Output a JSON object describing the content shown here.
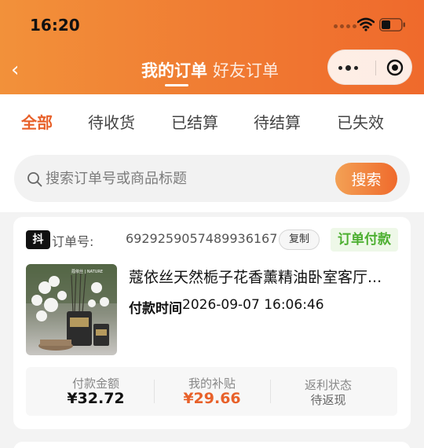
{
  "status_bar": {
    "time": "16:20"
  },
  "header": {
    "tab_mine": "我的订单",
    "tab_friend": "好友订单",
    "back_icon": "chevron-left-icon",
    "more_icon": "more-dots-icon",
    "close_icon": "target-close-icon"
  },
  "filters": [
    "全部",
    "待收货",
    "已结算",
    "待结算",
    "已失效"
  ],
  "active_filter": "全部",
  "search": {
    "placeholder": "搜索订单号或商品标题",
    "button": "搜索"
  },
  "order": {
    "platform_badge": "抖",
    "order_no_label": "订单号:",
    "order_no": "6929259057489936167",
    "copy_button": "复制",
    "status": "订单付款",
    "product_title": "蔻依丝天然栀子花香薰精油卧室客厅...",
    "pay_time_label": "付款时间",
    "pay_time": "2026-09-07 16:06:46",
    "summary": {
      "amount_label": "付款金额",
      "amount": "¥32.72",
      "subsidy_label": "我的补贴",
      "subsidy": "¥29.66",
      "rebate_label": "返利状态",
      "rebate_status": "待返现"
    }
  },
  "colors": {
    "accent": "#e8612a",
    "status_green": "#4caf30",
    "header_start": "#f2913a",
    "header_end": "#ef6a2c"
  }
}
